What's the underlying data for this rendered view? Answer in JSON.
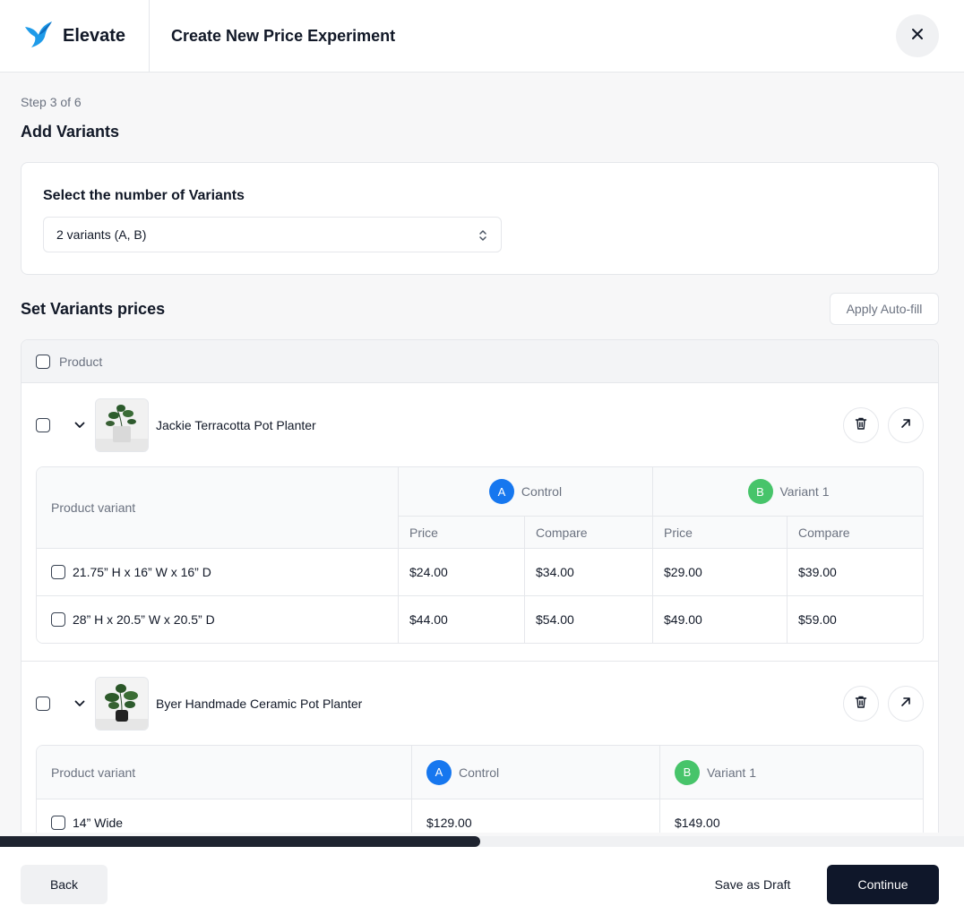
{
  "app": {
    "brand": "Elevate",
    "title": "Create New Price Experiment"
  },
  "step": {
    "label": "Step 3 of 6",
    "heading": "Add Variants"
  },
  "variants_card": {
    "label": "Select the number of Variants",
    "selected": "2 variants (A, B)"
  },
  "prices": {
    "heading": "Set Variants prices",
    "autofill_label": "Apply Auto-fill",
    "column_product": "Product"
  },
  "variant_headers": {
    "product_variant": "Product variant",
    "control_badge": "A",
    "control_label": "Control",
    "variant1_badge": "B",
    "variant1_label": "Variant 1",
    "price": "Price",
    "compare": "Compare"
  },
  "products": [
    {
      "name": "Jackie Terracotta Pot Planter",
      "rows": [
        {
          "variant": "21.75” H x 16” W x 16” D",
          "a_price": "$24.00",
          "a_compare": "$34.00",
          "b_price": "$29.00",
          "b_compare": "$39.00"
        },
        {
          "variant": "28” H x 20.5” W x 20.5” D",
          "a_price": "$44.00",
          "a_compare": "$54.00",
          "b_price": "$49.00",
          "b_compare": "$59.00"
        }
      ]
    },
    {
      "name": "Byer Handmade Ceramic Pot Planter",
      "rows": [
        {
          "variant": "14” Wide",
          "a_price": "$129.00",
          "b_price": "$149.00"
        }
      ]
    }
  ],
  "footer": {
    "back": "Back",
    "draft": "Save as Draft",
    "continue": "Continue"
  },
  "colors": {
    "accent_a": "#1677ef",
    "accent_b": "#47c46a",
    "primary_button": "#0f172a",
    "logo": "#1e9be9"
  },
  "scroll": {
    "horizontal_fraction": 0.5
  }
}
